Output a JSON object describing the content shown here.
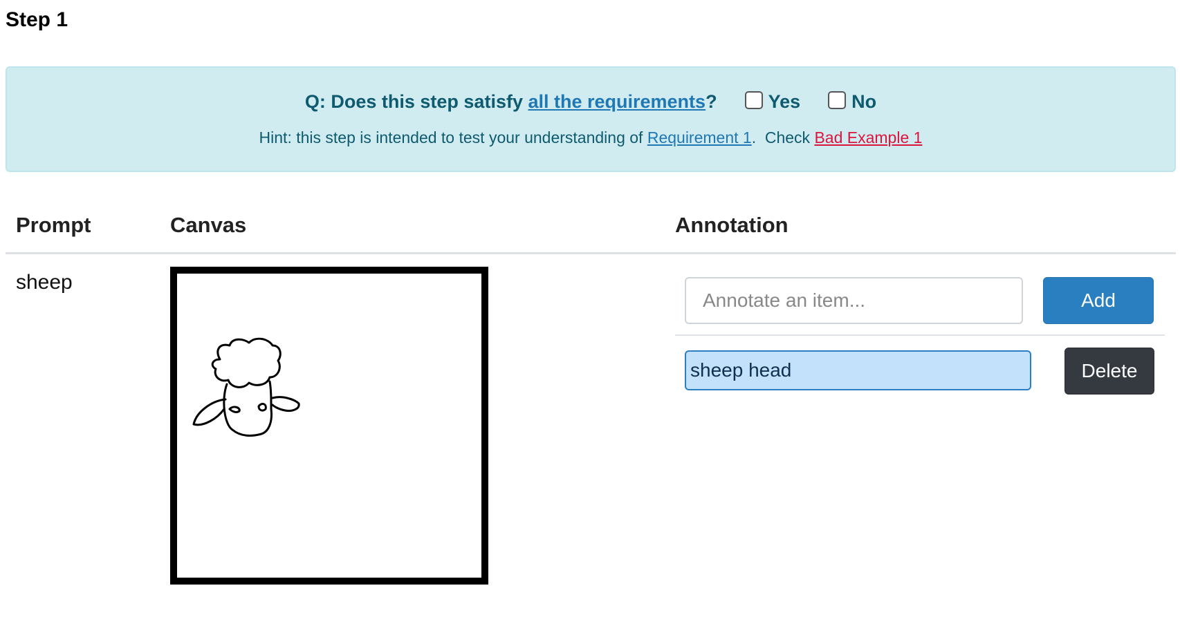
{
  "step": {
    "title": "Step 1"
  },
  "question": {
    "prefix": "Q: Does this step satisfy ",
    "link": "all the requirements",
    "suffix": "?",
    "yes_label": "Yes",
    "no_label": "No"
  },
  "hint": {
    "prefix": "Hint: this step is intended to test your understanding of ",
    "requirement_link": "Requirement 1",
    "middle": ".  Check ",
    "bad_example_link": "Bad Example 1"
  },
  "columns": {
    "prompt": "Prompt",
    "canvas": "Canvas",
    "annotation": "Annotation"
  },
  "row": {
    "prompt": "sheep"
  },
  "annotation": {
    "placeholder": "Annotate an item...",
    "add_label": "Add",
    "items": [
      {
        "text": "sheep head",
        "delete_label": "Delete"
      }
    ]
  },
  "colors": {
    "alert_bg": "#d1ecf1",
    "link": "#1f78b4",
    "bad_link": "#dc143c",
    "add_button": "#2a7fc1",
    "delete_button": "#343a40",
    "selected_item": "#c4e1fb"
  }
}
